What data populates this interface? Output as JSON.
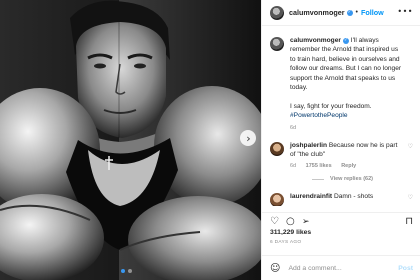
{
  "post": {
    "username": "calumvonmoger",
    "follow_label": "Follow",
    "separator": "•",
    "more_icon": "•••",
    "caption": {
      "username": "calumvonmoger",
      "text": "I'll always remember the Arnold that inspired us to train hard, believe in ourselves and follow our dreams. But I can no longer support the Arnold that speaks to us today.",
      "line2": "I say, fight for your freedom.",
      "hashtag": "#PowertothePeople",
      "age": "6d"
    },
    "comments": [
      {
        "username": "joshpalerlin",
        "text": "Because now he is part of \"the club\"",
        "age": "6d",
        "likes": "1755 likes",
        "reply": "Reply",
        "view_replies": "View replies (62)"
      },
      {
        "username": "laurendrainfit",
        "text": "Damn - shots"
      }
    ],
    "likes_count": "311,229 likes",
    "posted_ago": "6 DAYS AGO",
    "add_comment_placeholder": "Add a comment...",
    "post_button": "Post",
    "carousel": {
      "total": 2,
      "active": 0
    }
  },
  "colors": {
    "link": "#0095f6",
    "verified": "#3897f0",
    "muted": "#8e8e8e",
    "post_disabled": "#b2dffc"
  },
  "icons": [
    "verified-icon",
    "more-options-icon",
    "heart-icon",
    "comment-icon",
    "share-icon",
    "bookmark-icon",
    "emoji-icon",
    "next-arrow-icon"
  ]
}
